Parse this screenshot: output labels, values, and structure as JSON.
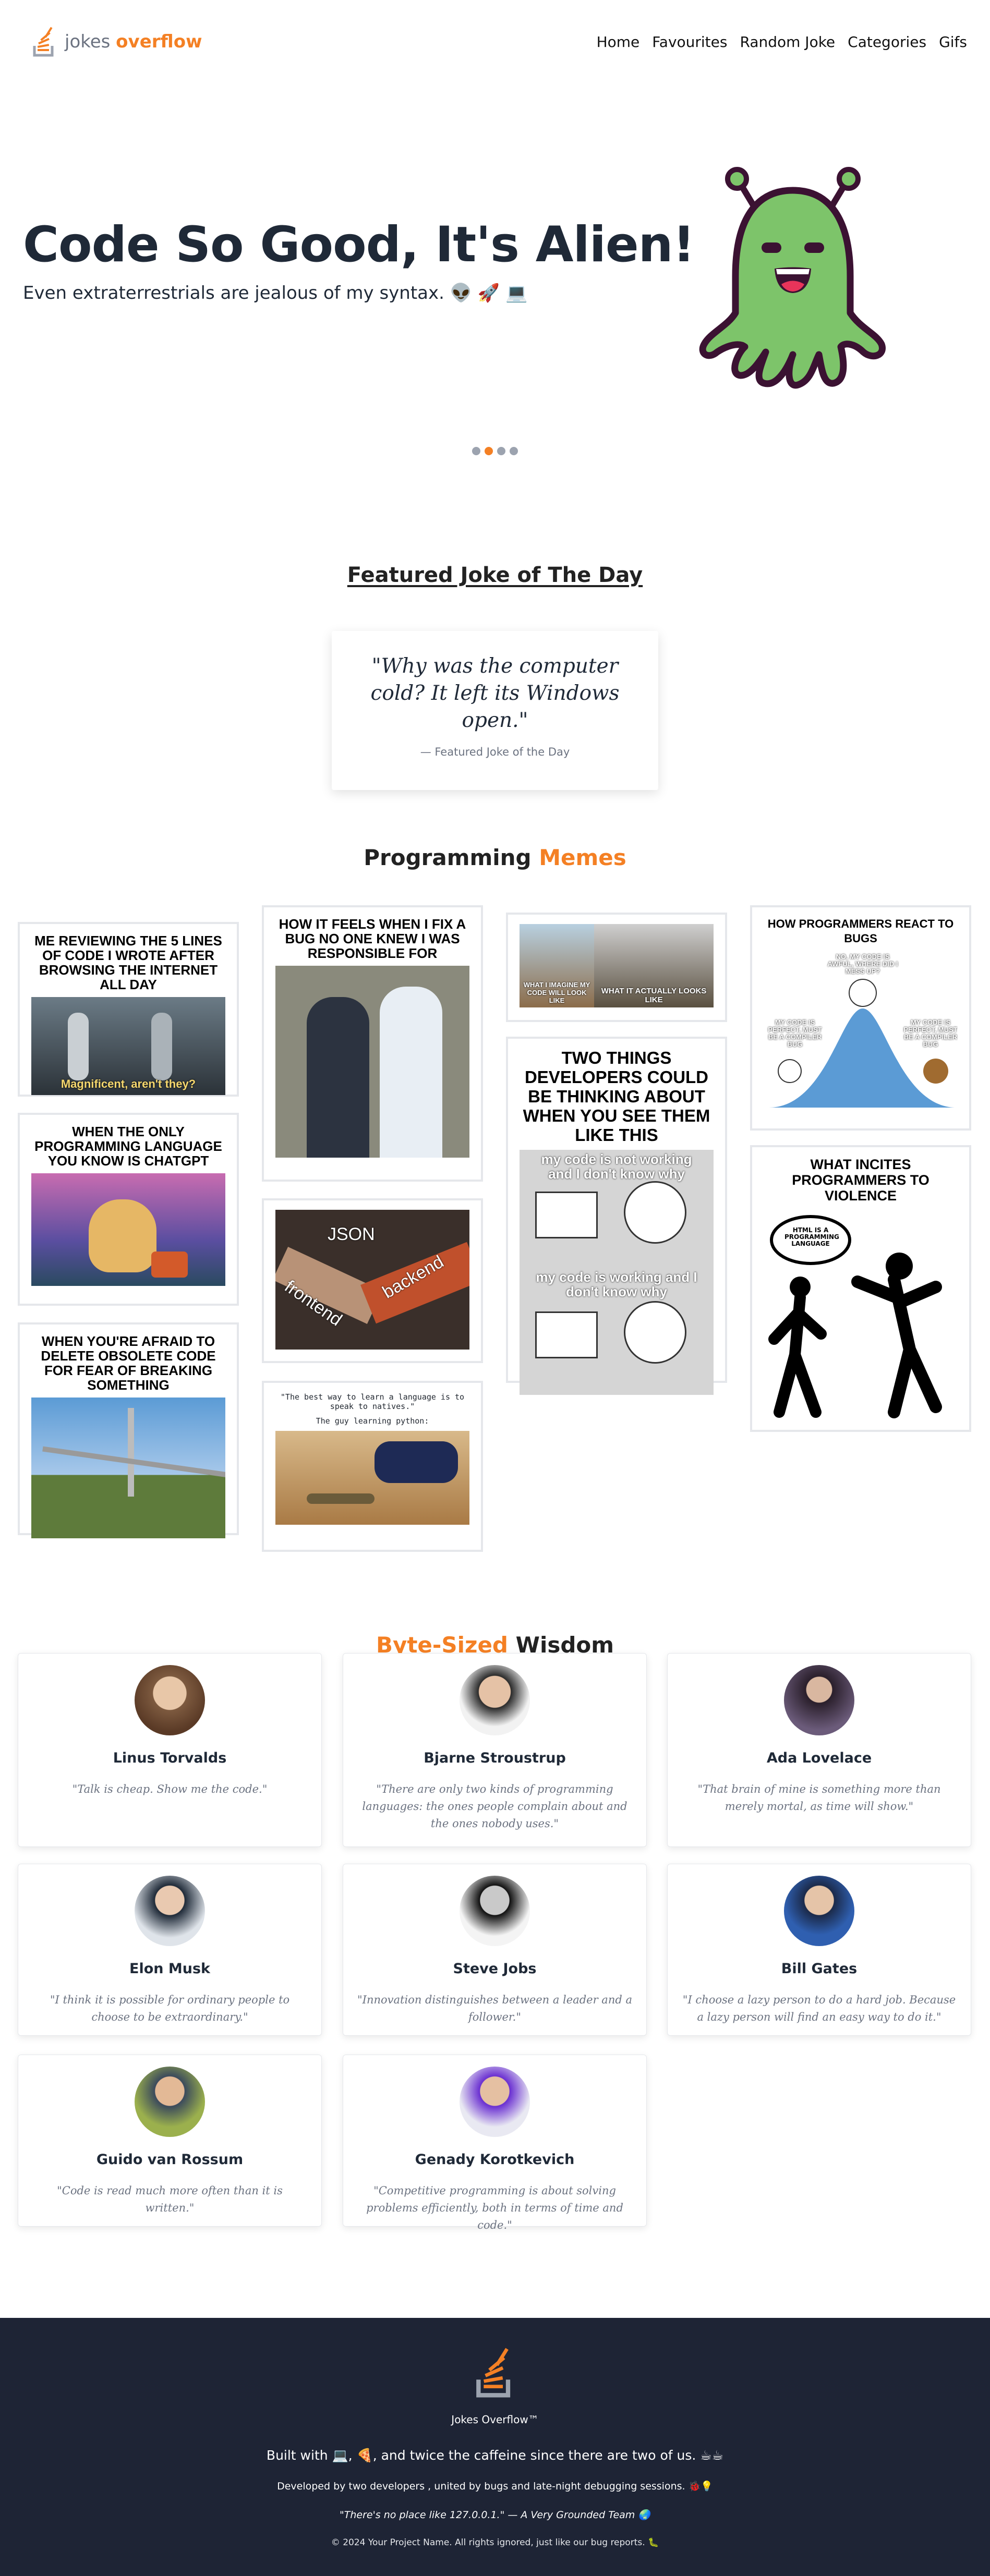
{
  "brand": {
    "part1": "jokes",
    "part2": "overflow"
  },
  "nav": [
    "Home",
    "Favourites",
    "Random Joke",
    "Categories",
    "Gifs"
  ],
  "hero": {
    "title": "Code So Good, It's Alien!",
    "subtitle": "Even extraterrestrials are jealous of my syntax. 👽 🚀 💻",
    "slides": 4,
    "active_slide": 1
  },
  "featured": {
    "heading": "Featured Joke of The Day",
    "quote": "\"Why was the computer cold? It left its Windows open.\"",
    "caption": "— Featured Joke of the Day"
  },
  "memes": {
    "title_part1": "Programming",
    "title_part2": "Memes",
    "items": [
      {
        "caption": "ME REVIEWING THE 5 LINES OF CODE I WROTE AFTER BROWSING THE INTERNET ALL DAY",
        "img_text": "Magnificent, aren't they?"
      },
      {
        "caption": "WHEN THE ONLY PROGRAMMING LANGUAGE YOU KNOW IS CHATGPT"
      },
      {
        "caption": "WHEN YOU'RE AFRAID TO DELETE OBSOLETE CODE FOR FEAR OF BREAKING SOMETHING"
      },
      {
        "caption": "HOW IT FEELS WHEN I FIX A BUG NO ONE KNEW I WAS RESPONSIBLE FOR"
      },
      {
        "img_text_1": "JSON",
        "img_text_2": "frontend",
        "img_text_3": "backend"
      },
      {
        "caption": "\"The best way to learn a language is to speak to natives.\"",
        "caption2": "The guy learning python:"
      },
      {
        "img_text_1": "WHAT I IMAGINE MY CODE WILL LOOK LIKE",
        "img_text_2": "WHAT IT ACTUALLY LOOKS LIKE"
      },
      {
        "caption": "TWO THINGS DEVELOPERS COULD BE THINKING ABOUT WHEN YOU SEE THEM LIKE THIS",
        "img_text_1": "my code is not working and I don't know why",
        "img_text_2": "my code is working and I don't know why"
      },
      {
        "caption": "HOW PROGRAMMERS REACT TO BUGS",
        "img_text_1": "NO, MY CODE IS AWFUL, WHERE DID I MESS UP?",
        "img_text_2": "MY CODE IS PERFECT, MUST BE A COMPILER BUG",
        "img_text_3": "MY CODE IS PERFECT, MUST BE A COMPILER BUG"
      },
      {
        "caption": "WHAT INCITES PROGRAMMERS TO VIOLENCE",
        "img_text": "HTML IS A PROGRAMMING LANGUAGE"
      }
    ]
  },
  "wisdom": {
    "title_part1": "Byte-Sized",
    "title_part2": "Wisdom",
    "items": [
      {
        "name": "Linus Torvalds",
        "quote": "\"Talk is cheap. Show me the code.\""
      },
      {
        "name": "Bjarne Stroustrup",
        "quote": "\"There are only two kinds of programming languages: the ones people complain about and the ones nobody uses.\""
      },
      {
        "name": "Ada Lovelace",
        "quote": "\"That brain of mine is something more than merely mortal, as time will show.\""
      },
      {
        "name": "Elon Musk",
        "quote": "\"I think it is possible for ordinary people to choose to be extraordinary.\""
      },
      {
        "name": "Steve Jobs",
        "quote": "\"Innovation distinguishes between a leader and a follower.\""
      },
      {
        "name": "Bill Gates",
        "quote": "\"I choose a lazy person to do a hard job. Because a lazy person will find an easy way to do it.\""
      },
      {
        "name": "Guido van Rossum",
        "quote": "\"Code is read much more often than it is written.\""
      },
      {
        "name": "Genady Korotkevich",
        "quote": "\"Competitive programming is about solving problems efficiently, both in terms of time and code.\""
      }
    ]
  },
  "footer": {
    "name": "Jokes Overflow™",
    "line1": "Built with 💻, 🍕, and twice the caffeine since there are two of us. ☕☕",
    "line2": "Developed by two developers , united by bugs and late-night debugging sessions. 🐞💡",
    "line3": "\"There's no place like 127.0.0.1.\" — A Very Grounded Team 🌏",
    "line4": "© 2024 Your Project Name. All rights ignored, just like our bug reports. 🐛"
  },
  "colors": {
    "accent": "#f48024",
    "footer_bg": "#1e2435",
    "alien_green": "#7dc46a",
    "alien_outline": "#3b1232"
  }
}
